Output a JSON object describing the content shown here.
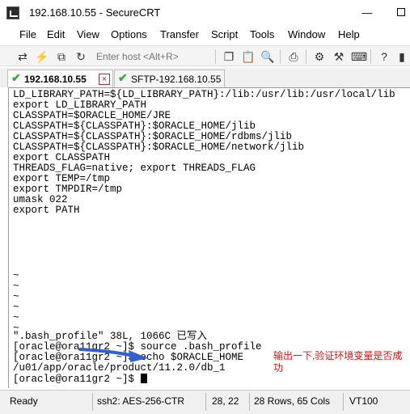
{
  "window": {
    "title": "192.168.10.55 - SecureCRT"
  },
  "menu": [
    "File",
    "Edit",
    "View",
    "Options",
    "Transfer",
    "Script",
    "Tools",
    "Window",
    "Help"
  ],
  "toolbar": {
    "host_placeholder": "Enter host <Alt+R>"
  },
  "tabs": [
    {
      "label": "192.168.10.55",
      "active": true
    },
    {
      "label": "SFTP-192.168.10.55",
      "active": false
    }
  ],
  "terminal": {
    "lines": [
      "LD_LIBRARY_PATH=${LD_LIBRARY_PATH}:/lib:/usr/lib:/usr/local/lib",
      "export LD_LIBRARY_PATH",
      "CLASSPATH=$ORACLE_HOME/JRE",
      "CLASSPATH=${CLASSPATH}:$ORACLE_HOME/jlib",
      "CLASSPATH=${CLASSPATH}:$ORACLE_HOME/rdbms/jlib",
      "CLASSPATH=${CLASSPATH}:$ORACLE_HOME/network/jlib",
      "export CLASSPATH",
      "THREADS_FLAG=native; export THREADS_FLAG",
      "export TEMP=/tmp",
      "export TMPDIR=/tmp",
      "umask 022",
      "export PATH",
      "~",
      "~",
      "~",
      "~",
      "~",
      "~",
      "\".bash_profile\" 38L, 1066C 已写入",
      "[oracle@ora11gr2 ~]$ source .bash_profile",
      "[oracle@ora11gr2 ~]$ echo $ORACLE_HOME",
      "/u01/app/oracle/product/11.2.0/db_1",
      "[oracle@ora11gr2 ~]$ "
    ]
  },
  "annotation": {
    "text": "输出一下,验证环境变量是否成功",
    "color": "#e01010"
  },
  "status": {
    "state": "Ready",
    "cipher": "ssh2: AES-256-CTR",
    "cursor": "28,  22",
    "size": "28 Rows, 65 Cols",
    "terminal_type": "VT100"
  }
}
